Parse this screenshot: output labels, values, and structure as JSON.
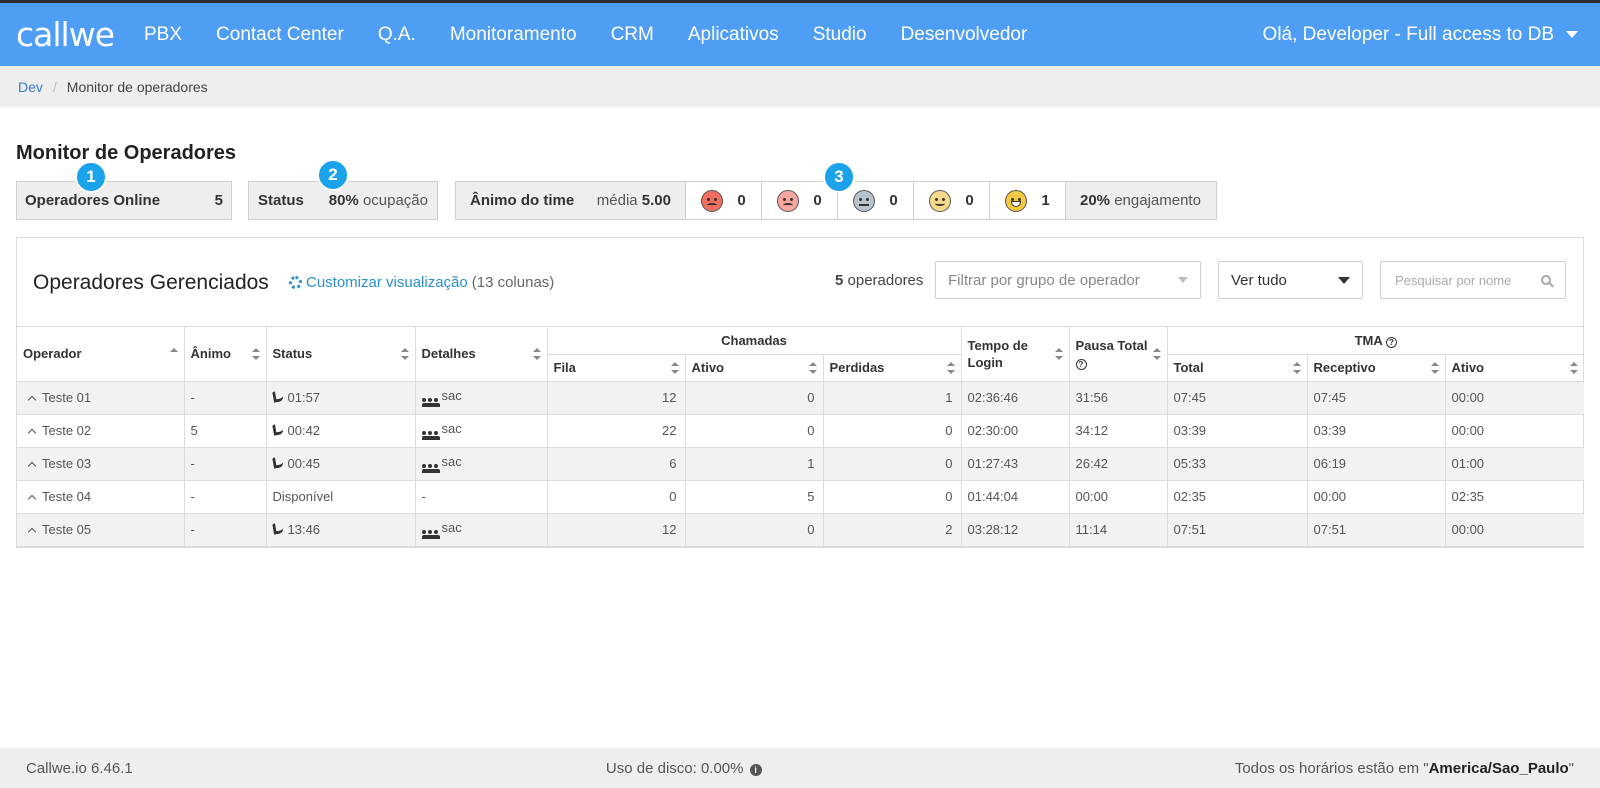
{
  "nav": {
    "logo": "callwe",
    "items": [
      "PBX",
      "Contact Center",
      "Q.A.",
      "Monitoramento",
      "CRM",
      "Aplicativos",
      "Studio",
      "Desenvolvedor"
    ],
    "user": "Olá, Developer - Full access to DB"
  },
  "breadcrumb": {
    "root": "Dev",
    "sep": "/",
    "current": "Monitor de operadores"
  },
  "title": "Monitor de Operadores",
  "markers": [
    "1",
    "2",
    "3"
  ],
  "stats": {
    "online_label": "Operadores Online",
    "online_value": "5",
    "status_label": "Status",
    "status_pct": "80%",
    "status_suffix": "ocupação",
    "mood_label": "Ânimo do time",
    "mood_avg_label": "média",
    "mood_avg_value": "5.00",
    "faces": [
      {
        "icon": "angry-face-icon",
        "count": "0"
      },
      {
        "icon": "sad-face-icon",
        "count": "0"
      },
      {
        "icon": "neutral-face-icon",
        "count": "0"
      },
      {
        "icon": "smile-face-icon",
        "count": "0"
      },
      {
        "icon": "happy-face-icon",
        "count": "1"
      }
    ],
    "engagement_pct": "20%",
    "engagement_label": "engajamento"
  },
  "panel": {
    "title": "Operadores Gerenciados",
    "customize_label": "Customizar visualização",
    "customize_count": "(13 colunas)",
    "operators_count": "5",
    "operators_label": "operadores",
    "group_filter_placeholder": "Filtrar por grupo de operador",
    "view_select": "Ver tudo",
    "search_placeholder": "Pesquisar por nome"
  },
  "table": {
    "headers": {
      "operador": "Operador",
      "animo": "Ânimo",
      "status": "Status",
      "detalhes": "Detalhes",
      "chamadas": "Chamadas",
      "fila": "Fila",
      "ativo": "Ativo",
      "perdidas": "Perdidas",
      "tempo_login": "Tempo de Login",
      "pausa_total": "Pausa Total",
      "tma": "TMA",
      "total": "Total",
      "receptivo": "Receptivo",
      "tma_ativo": "Ativo"
    },
    "rows": [
      {
        "operador": "Teste 01",
        "animo": "-",
        "status": "01:57",
        "on_call": true,
        "detalhes": "sac",
        "fila": "12",
        "ativo": "0",
        "perdidas": "1",
        "login": "02:36:46",
        "pausa": "31:56",
        "tma_total": "07:45",
        "tma_receptivo": "07:45",
        "tma_ativo": "00:00"
      },
      {
        "operador": "Teste 02",
        "animo": "5",
        "status": "00:42",
        "on_call": true,
        "detalhes": "sac",
        "fila": "22",
        "ativo": "0",
        "perdidas": "0",
        "login": "02:30:00",
        "pausa": "34:12",
        "tma_total": "03:39",
        "tma_receptivo": "03:39",
        "tma_ativo": "00:00"
      },
      {
        "operador": "Teste 03",
        "animo": "-",
        "status": "00:45",
        "on_call": true,
        "detalhes": "sac",
        "fila": "6",
        "ativo": "1",
        "perdidas": "0",
        "login": "01:27:43",
        "pausa": "26:42",
        "tma_total": "05:33",
        "tma_receptivo": "06:19",
        "tma_ativo": "01:00"
      },
      {
        "operador": "Teste 04",
        "animo": "-",
        "status": "Disponível",
        "on_call": false,
        "detalhes": "-",
        "fila": "0",
        "ativo": "5",
        "perdidas": "0",
        "login": "01:44:04",
        "pausa": "00:00",
        "tma_total": "02:35",
        "tma_receptivo": "00:00",
        "tma_ativo": "02:35"
      },
      {
        "operador": "Teste 05",
        "animo": "-",
        "status": "13:46",
        "on_call": true,
        "detalhes": "sac",
        "fila": "12",
        "ativo": "0",
        "perdidas": "2",
        "login": "03:28:12",
        "pausa": "11:14",
        "tma_total": "07:51",
        "tma_receptivo": "07:51",
        "tma_ativo": "00:00"
      }
    ]
  },
  "footer": {
    "version": "Callwe.io 6.46.1",
    "disk_label": "Uso de disco: 0.00%",
    "tz_prefix": "Todos os horários estão em \"",
    "tz_value": "America/Sao_Paulo",
    "tz_suffix": "\""
  },
  "colors": {
    "navbar": "#4f9ef5",
    "marker": "#1aa3ea",
    "link": "#2a8fd0"
  }
}
